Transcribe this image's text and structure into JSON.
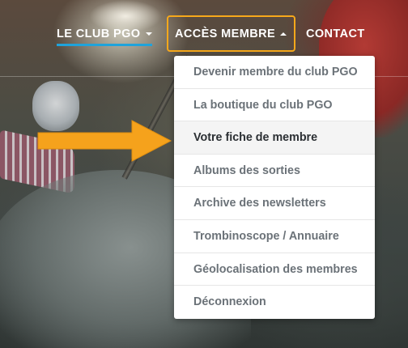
{
  "nav": {
    "club_label": "LE CLUB PGO",
    "acces_label": "ACCÈS MEMBRE",
    "contact_label": "CONTACT"
  },
  "dropdown": {
    "items": [
      {
        "label": "Devenir membre du club PGO"
      },
      {
        "label": "La boutique du club PGO"
      },
      {
        "label": "Votre fiche de membre",
        "active": true
      },
      {
        "label": "Albums des sorties"
      },
      {
        "label": "Archive des newsletters"
      },
      {
        "label": "Trombinoscope / Annuaire"
      },
      {
        "label": "Géolocalisation des membres"
      },
      {
        "label": "Déconnexion"
      }
    ]
  },
  "colors": {
    "accent_orange": "#f6a81b",
    "accent_blue": "#1fa3db",
    "arrow": "#f5a21c"
  },
  "annotation": {
    "icon": "arrow-right-icon"
  }
}
